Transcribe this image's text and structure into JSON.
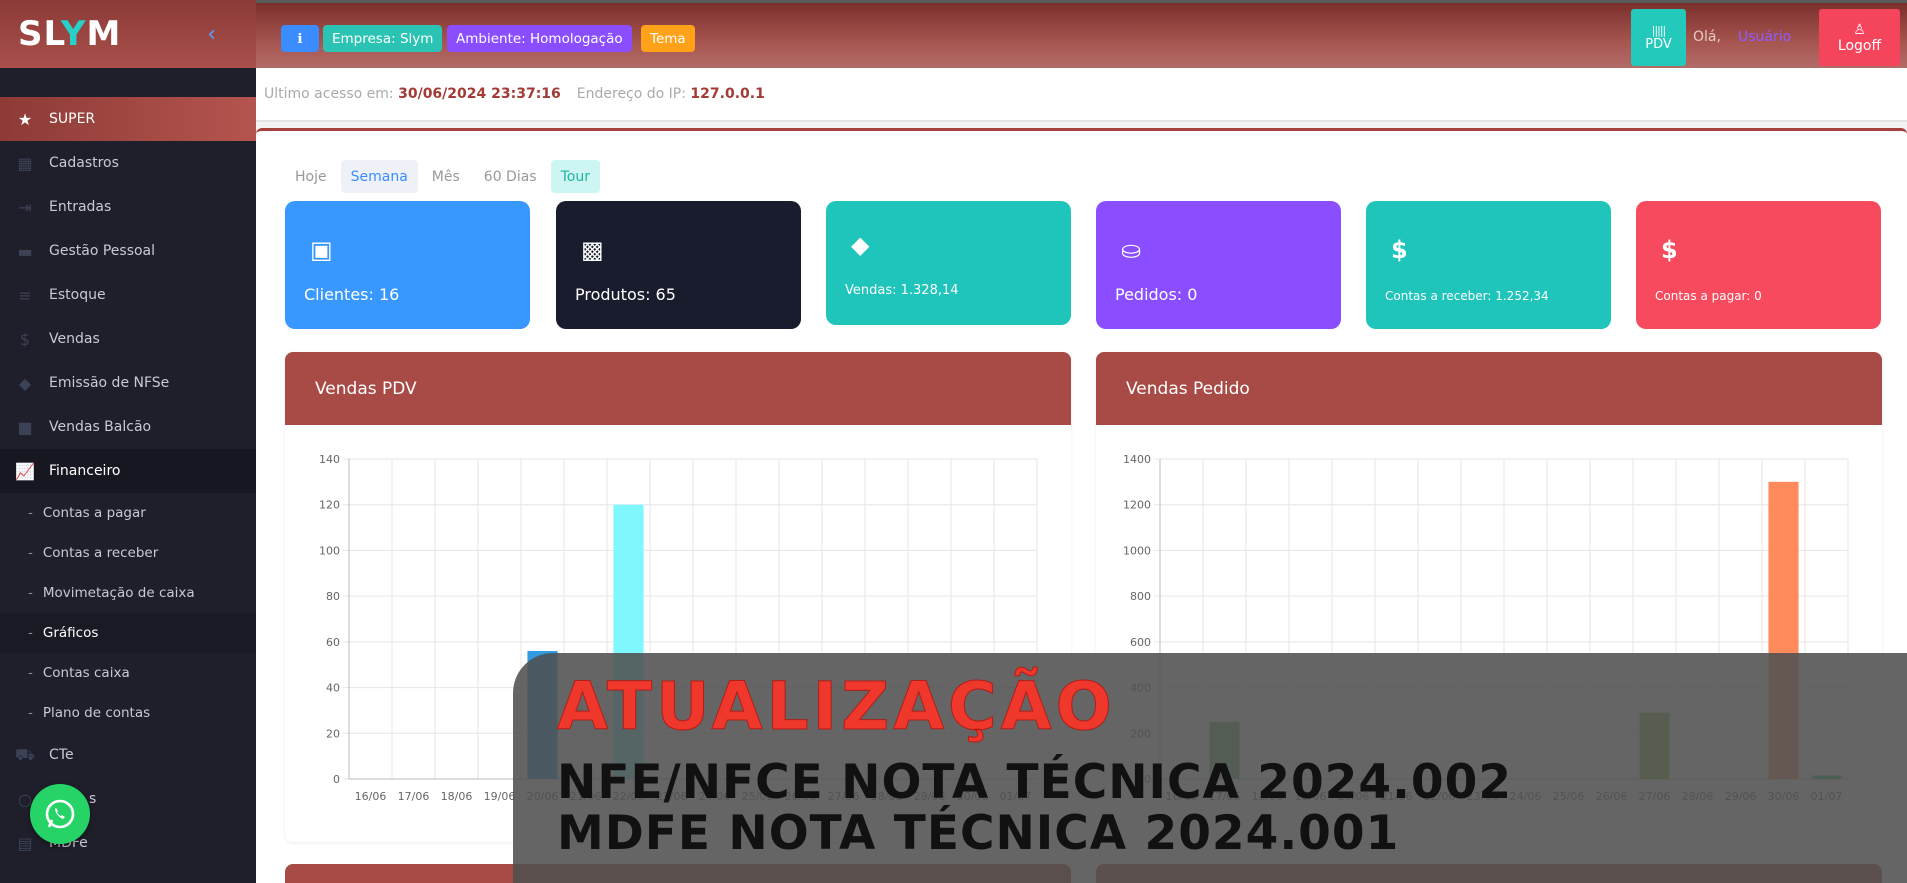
{
  "app": {
    "logo_pre": "SL",
    "logo_y": "Y",
    "logo_post": "M"
  },
  "sidebar": {
    "items": [
      {
        "label": "SUPER",
        "icon": "star-icon"
      },
      {
        "label": "Cadastros",
        "icon": "grid-icon"
      },
      {
        "label": "Entradas",
        "icon": "login-icon"
      },
      {
        "label": "Gestão Pessoal",
        "icon": "folder-icon"
      },
      {
        "label": "Estoque",
        "icon": "list-icon"
      },
      {
        "label": "Vendas",
        "icon": "dollar-icon"
      },
      {
        "label": "Emissão de NFSe",
        "icon": "tag-icon"
      },
      {
        "label": "Vendas Balcão",
        "icon": "bag-icon"
      },
      {
        "label": "Financeiro",
        "icon": "chart-line-icon"
      }
    ],
    "sub_items": [
      {
        "label": "Contas a pagar"
      },
      {
        "label": "Contas a receber"
      },
      {
        "label": "Movimetação de caixa"
      },
      {
        "label": "Gráficos"
      },
      {
        "label": "Contas caixa"
      },
      {
        "label": "Plano de contas"
      }
    ],
    "bottom_items": [
      {
        "label": "CTe",
        "icon": "truck-icon"
      },
      {
        "label": "s",
        "icon": "search-icon"
      },
      {
        "label": "MDFe",
        "icon": "document-icon"
      }
    ]
  },
  "topbar": {
    "info_icon": "info-icon",
    "empresa": "Empresa: Slym",
    "ambiente": "Ambiente: Homologação",
    "tema": "Tema",
    "pdv": "PDV",
    "hello": "Olá,",
    "user": "Usuário",
    "logoff": "Logoff"
  },
  "access": {
    "last_label": "Ultimo acesso em:",
    "last_value": "30/06/2024 23:37:16",
    "ip_label": "Endereço do IP:",
    "ip_value": "127.0.0.1"
  },
  "periods": [
    "Hoje",
    "Semana",
    "Mês",
    "60 Dias",
    "Tour"
  ],
  "stats": [
    {
      "label": "Clientes: 16",
      "color": "#3898ff"
    },
    {
      "label": "Produtos: 65",
      "color": "#191c2d"
    },
    {
      "label": "Vendas: 1.328,14",
      "color": "#1fc4ba"
    },
    {
      "label": "Pedidos: 0",
      "color": "#8a4dff"
    },
    {
      "label": "Contas a receber: 1.252,34",
      "color": "#1fc4ba"
    },
    {
      "label": "Contas a pagar: 0",
      "color": "#f74a5e"
    }
  ],
  "panels": {
    "pdv_title": "Vendas PDV",
    "pedido_title": "Vendas Pedido"
  },
  "chart_data": [
    {
      "type": "bar",
      "title": "Vendas PDV",
      "categories": [
        "16/06",
        "17/06",
        "18/06",
        "19/06",
        "20/06",
        "21/06",
        "22/06",
        "23/06",
        "24/06",
        "25/06",
        "26/06",
        "27/06",
        "28/06",
        "29/06",
        "30/06",
        "01/07"
      ],
      "values": [
        0,
        0,
        0,
        0,
        56,
        0,
        120,
        0,
        0,
        0,
        0,
        0,
        0,
        0,
        0,
        0
      ],
      "colors": [
        "#36a2eb",
        "#36a2eb",
        "#36a2eb",
        "#36a2eb",
        "#2f9be0",
        "#36a2eb",
        "#7ff7ff",
        "#36a2eb",
        "#36a2eb",
        "#36a2eb",
        "#36a2eb",
        "#36a2eb",
        "#36a2eb",
        "#36a2eb",
        "#36a2eb",
        "#36a2eb"
      ],
      "ylim": [
        0,
        140
      ],
      "yticks": [
        0,
        20,
        40,
        60,
        80,
        100,
        120,
        140
      ],
      "grid": true
    },
    {
      "type": "bar",
      "title": "Vendas Pedido",
      "categories": [
        "16/06",
        "17/06",
        "18/06",
        "19/06",
        "20/06",
        "21/06",
        "22/06",
        "23/06",
        "24/06",
        "25/06",
        "26/06",
        "27/06",
        "28/06",
        "29/06",
        "30/06",
        "01/07"
      ],
      "values": [
        0,
        250,
        0,
        0,
        0,
        0,
        0,
        0,
        0,
        0,
        0,
        290,
        0,
        0,
        1300,
        15
      ],
      "colors": [
        "#7bd389",
        "#6fbf73",
        "#7bd389",
        "#7bd389",
        "#7bd389",
        "#7bd389",
        "#7bd389",
        "#7bd389",
        "#7bd389",
        "#7bd389",
        "#7bd389",
        "#8bc34a",
        "#7bd389",
        "#7bd389",
        "#ff8a5c",
        "#2ecc71"
      ],
      "ylim": [
        0,
        1400
      ],
      "yticks": [
        0,
        200,
        400,
        600,
        800,
        1000,
        1200,
        1400
      ],
      "grid": true
    }
  ],
  "overlay": {
    "line1": "ATUALIZAÇÃO",
    "line2": "NFE/NFCE NOTA TÉCNICA 2024.002",
    "line3": "MDFE NOTA TÉCNICA 2024.001"
  }
}
